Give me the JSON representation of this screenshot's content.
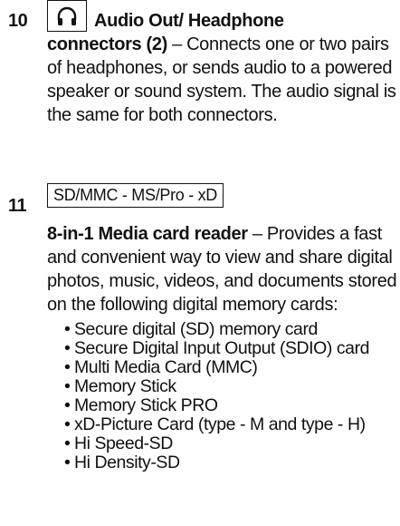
{
  "item10": {
    "number": "10",
    "icon": "headphone-icon",
    "title_line1": "Audio Out/ Headphone",
    "title_line2": "connectors (2)",
    "description": " – Connects one or two pairs of headphones, or sends audio to a powered speaker or sound system. The audio signal is the same for both connectors."
  },
  "item11": {
    "number": "11",
    "label": "SD/MMC - MS/Pro - xD",
    "title": "8-in-1 Media card reader",
    "description": " – Provides a fast and convenient way to view and share digital photos, music, videos, and documents stored on the following digital memory cards:",
    "cards": [
      "Secure digital (SD) memory card",
      "Secure Digital Input Output (SDIO) card",
      "Multi Media Card (MMC)",
      "Memory Stick",
      "Memory Stick PRO",
      "xD-Picture Card (type - M and type - H)",
      "Hi Speed-SD",
      "Hi Density-SD"
    ]
  }
}
